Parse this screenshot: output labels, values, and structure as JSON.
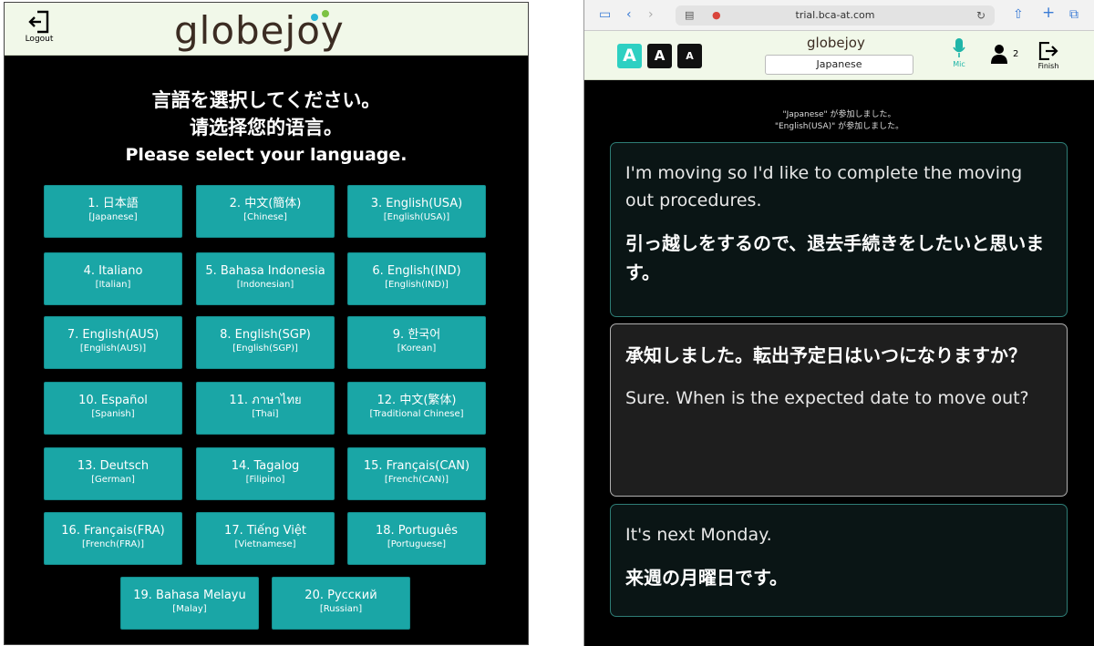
{
  "left": {
    "logout_label": "Logout",
    "logo_text": "globejoy",
    "prompt_lines": [
      "言語を選択してください。",
      "请选择您的语言。",
      "Please select your language."
    ],
    "languages": [
      {
        "name": "1. 日本語",
        "sub": "[Japanese]"
      },
      {
        "name": "2. 中文(簡体)",
        "sub": "[Chinese]"
      },
      {
        "name": "3. English(USA)",
        "sub": "[English(USA)]"
      },
      {
        "name": "4. Italiano",
        "sub": "[Italian]"
      },
      {
        "name": "5. Bahasa Indonesia",
        "sub": "[Indonesian]"
      },
      {
        "name": "6. English(IND)",
        "sub": "[English(IND)]"
      },
      {
        "name": "7. English(AUS)",
        "sub": "[English(AUS)]"
      },
      {
        "name": "8. English(SGP)",
        "sub": "[English(SGP)]"
      },
      {
        "name": "9. 한국어",
        "sub": "[Korean]"
      },
      {
        "name": "10. Español",
        "sub": "[Spanish]"
      },
      {
        "name": "11. ภาษาไทย",
        "sub": "[Thai]"
      },
      {
        "name": "12. 中文(繁体)",
        "sub": "[Traditional Chinese]"
      },
      {
        "name": "13. Deutsch",
        "sub": "[German]"
      },
      {
        "name": "14. Tagalog",
        "sub": "[Filipino]"
      },
      {
        "name": "15. Français(CAN)",
        "sub": "[French(CAN)]"
      },
      {
        "name": "16. Français(FRA)",
        "sub": "[French(FRA)]"
      },
      {
        "name": "17. Tiếng Việt",
        "sub": "[Vietnamese]"
      },
      {
        "name": "18. Português",
        "sub": "[Portuguese]"
      },
      {
        "name": "19. Bahasa Melayu",
        "sub": "[Malay]"
      },
      {
        "name": "20. Русский",
        "sub": "[Russian]"
      }
    ],
    "accent_color": "#1aa6a6"
  },
  "right": {
    "url": "trial.bca-at.com",
    "logo_text": "globejoy",
    "font_buttons": [
      "A",
      "A",
      "A"
    ],
    "selected_language": "Japanese",
    "mic_label": "Mic",
    "participants_count": "2",
    "finish_label": "Finish",
    "notices": [
      "\"Japanese\" が参加しました。",
      "\"English(USA)\" が参加しました。"
    ],
    "messages": [
      {
        "style": "teal",
        "first": "I'm moving so I'd like to complete the moving out procedures.",
        "first_lang": "en",
        "second": "引っ越しをするので、退去手続きをしたいと思います。",
        "second_lang": "ja"
      },
      {
        "style": "grey",
        "first": "承知しました。転出予定日はいつになりますか？",
        "first_lang": "ja",
        "second": "Sure. When is the expected date to move out?",
        "second_lang": "en"
      },
      {
        "style": "teal",
        "first": "It's next Monday.",
        "first_lang": "en",
        "second": "来週の月曜日です。",
        "second_lang": "ja"
      }
    ]
  }
}
